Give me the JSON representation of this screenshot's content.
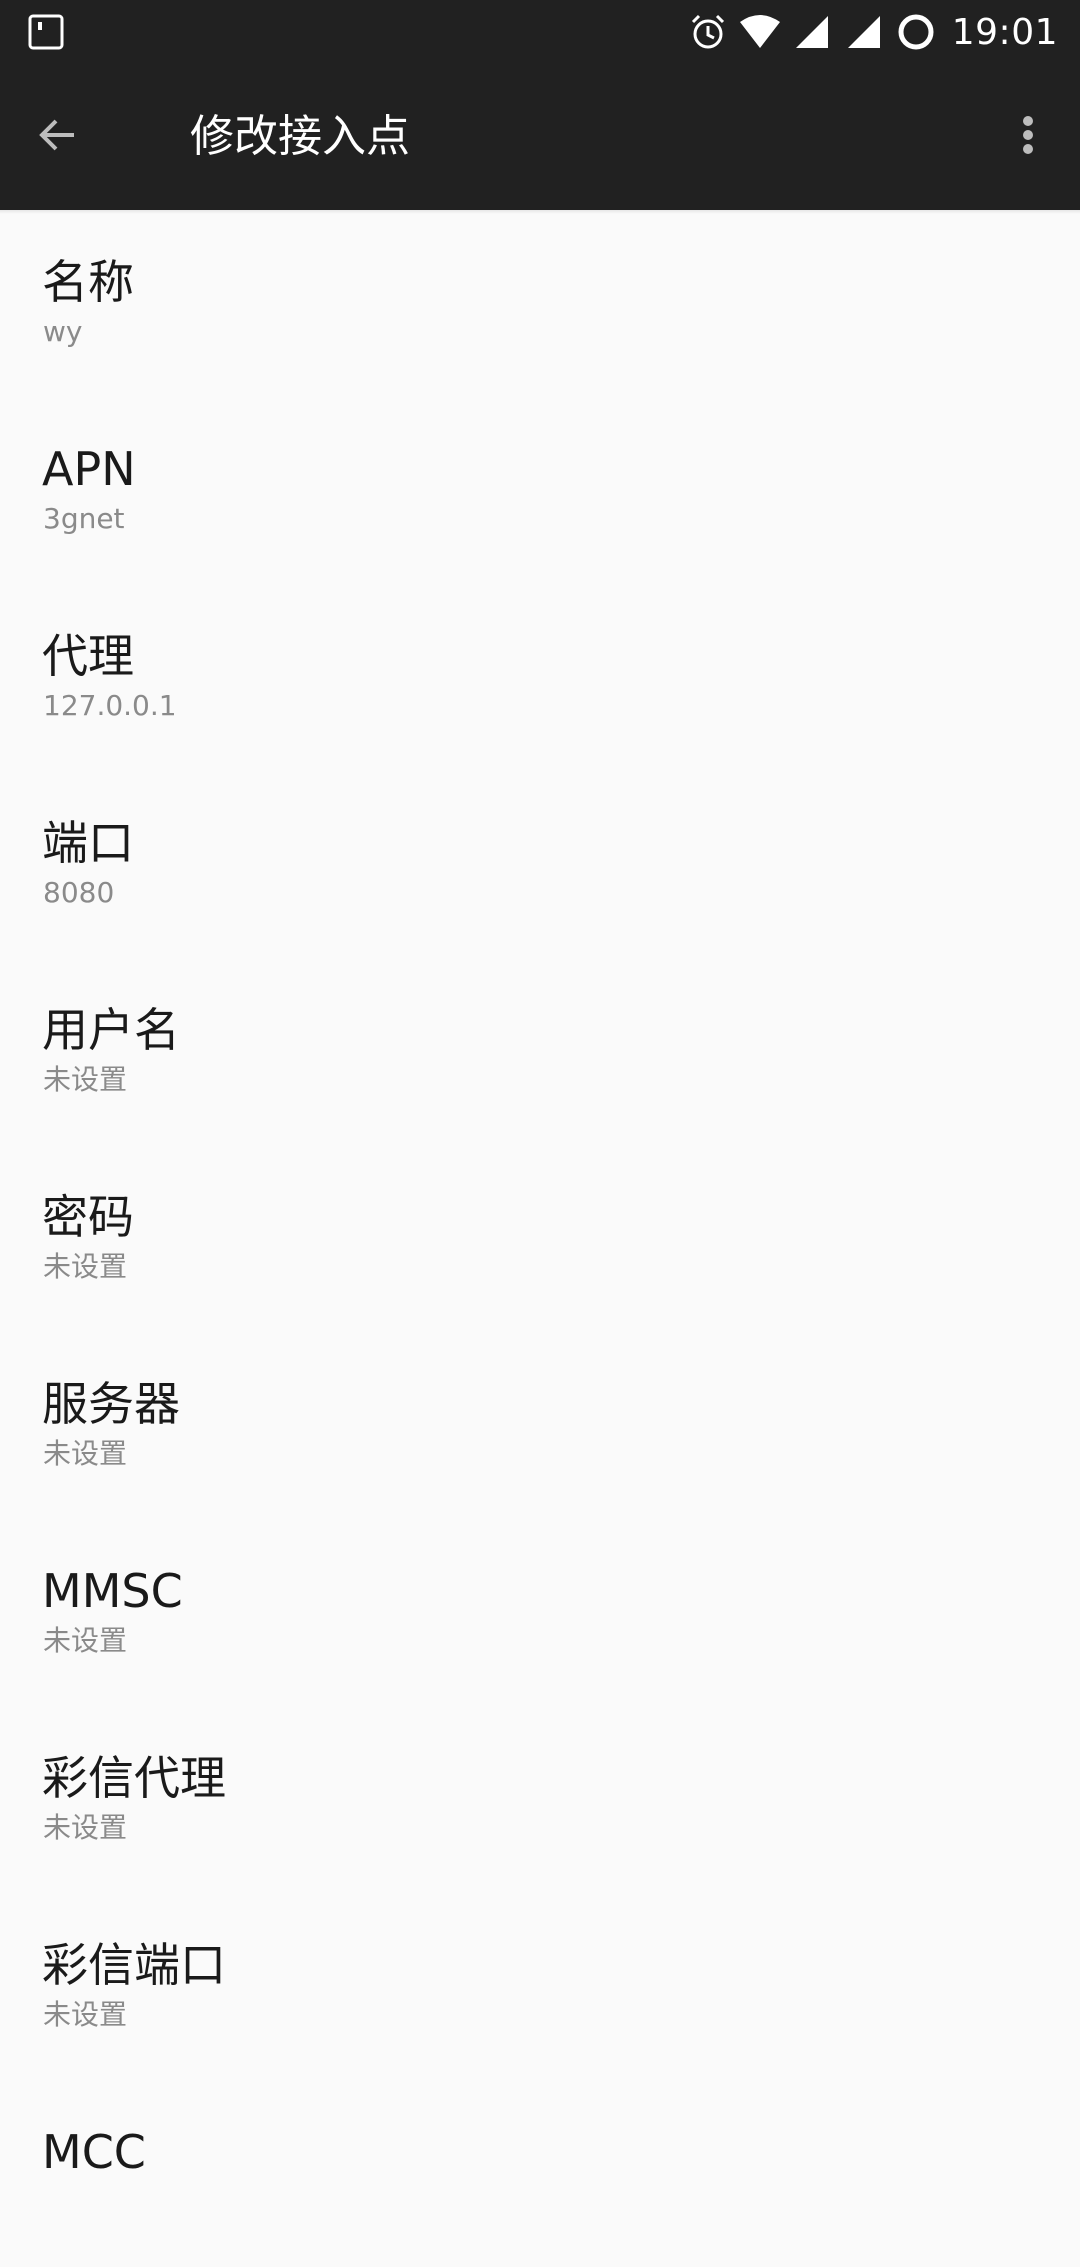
{
  "status_bar": {
    "time": "19:01",
    "icons": [
      "notification-square-icon",
      "alarm-icon",
      "wifi-icon",
      "signal-icon",
      "signal-icon",
      "battery-ring-icon"
    ]
  },
  "app_bar": {
    "title": "修改接入点",
    "back_icon": "arrow-back-icon",
    "more_icon": "more-vert-icon",
    "background": "#212121"
  },
  "items": [
    {
      "label": "名称",
      "value": "wy"
    },
    {
      "label": "APN",
      "value": "3gnet"
    },
    {
      "label": "代理",
      "value": "127.0.0.1"
    },
    {
      "label": "端口",
      "value": "8080"
    },
    {
      "label": "用户名",
      "value": "未设置"
    },
    {
      "label": "密码",
      "value": "未设置"
    },
    {
      "label": "服务器",
      "value": "未设置"
    },
    {
      "label": "MMSC",
      "value": "未设置"
    },
    {
      "label": "彩信代理",
      "value": "未设置"
    },
    {
      "label": "彩信端口",
      "value": "未设置"
    },
    {
      "label": "MCC",
      "value": ""
    }
  ]
}
